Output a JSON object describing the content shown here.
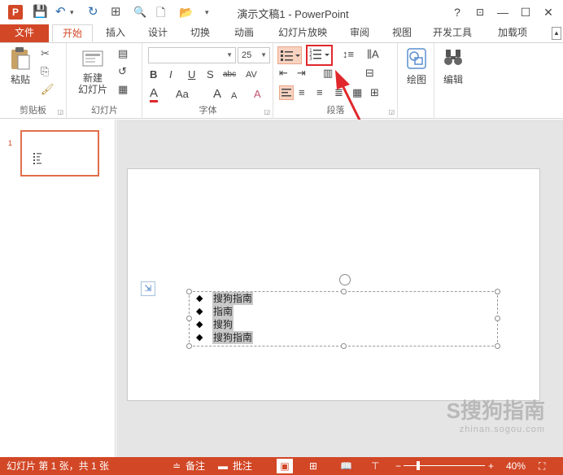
{
  "window": {
    "app_icon": "P",
    "title": "演示文稿1 - PowerPoint",
    "help": "?",
    "restore_ribbon": "⊡",
    "minimize": "—",
    "maximize": "☐",
    "close": "✕"
  },
  "qat": {
    "save": "💾",
    "undo": "↶",
    "undo_dd": "▾",
    "redo": "↻",
    "present": "⊞",
    "preview": "🔍",
    "new": "🗋",
    "open": "📂",
    "more": "▾"
  },
  "tabs": [
    "文件",
    "开始",
    "插入",
    "设计",
    "切换",
    "动画",
    "幻灯片放映",
    "审阅",
    "视图",
    "开发工具",
    "加载项"
  ],
  "tab_scroll": "▲",
  "ribbon": {
    "clipboard": {
      "label": "剪贴板",
      "paste": "粘贴",
      "cut": "✂",
      "copy": "⎘",
      "painter": "🖌"
    },
    "slides": {
      "label": "幻灯片",
      "new_slide_line1": "新建",
      "new_slide_line2": "幻灯片",
      "layout": "▤",
      "reset": "↺",
      "section": "▦"
    },
    "font": {
      "label": "字体",
      "family": "",
      "size": "25",
      "bold": "B",
      "italic": "I",
      "underline": "U",
      "shadow": "S",
      "strike": "abc",
      "spacing": "AV",
      "color": "A",
      "case": "Aa",
      "grow": "A",
      "shrink": "A",
      "clear": "A"
    },
    "paragraph": {
      "label": "段落"
    },
    "drawing": {
      "label": "绘图"
    },
    "editing": {
      "label": "编辑"
    }
  },
  "slide_panel": {
    "number": "1"
  },
  "textbox": {
    "bullets": [
      "搜狗指南",
      "指南",
      "搜狗",
      "搜狗指南"
    ],
    "bullet_glyph": "◆"
  },
  "watermark": {
    "main": "S搜狗指南",
    "sub": "zhinan.sogou.com"
  },
  "statusbar": {
    "slide_info": "幻灯片 第 1 张，共 1 张",
    "notes": "备注",
    "comments": "批注",
    "zoom": "40%",
    "zoom_minus": "−",
    "zoom_plus": "+"
  },
  "colors": {
    "accent": "#d24726",
    "highlight_box": "#e0282c"
  }
}
